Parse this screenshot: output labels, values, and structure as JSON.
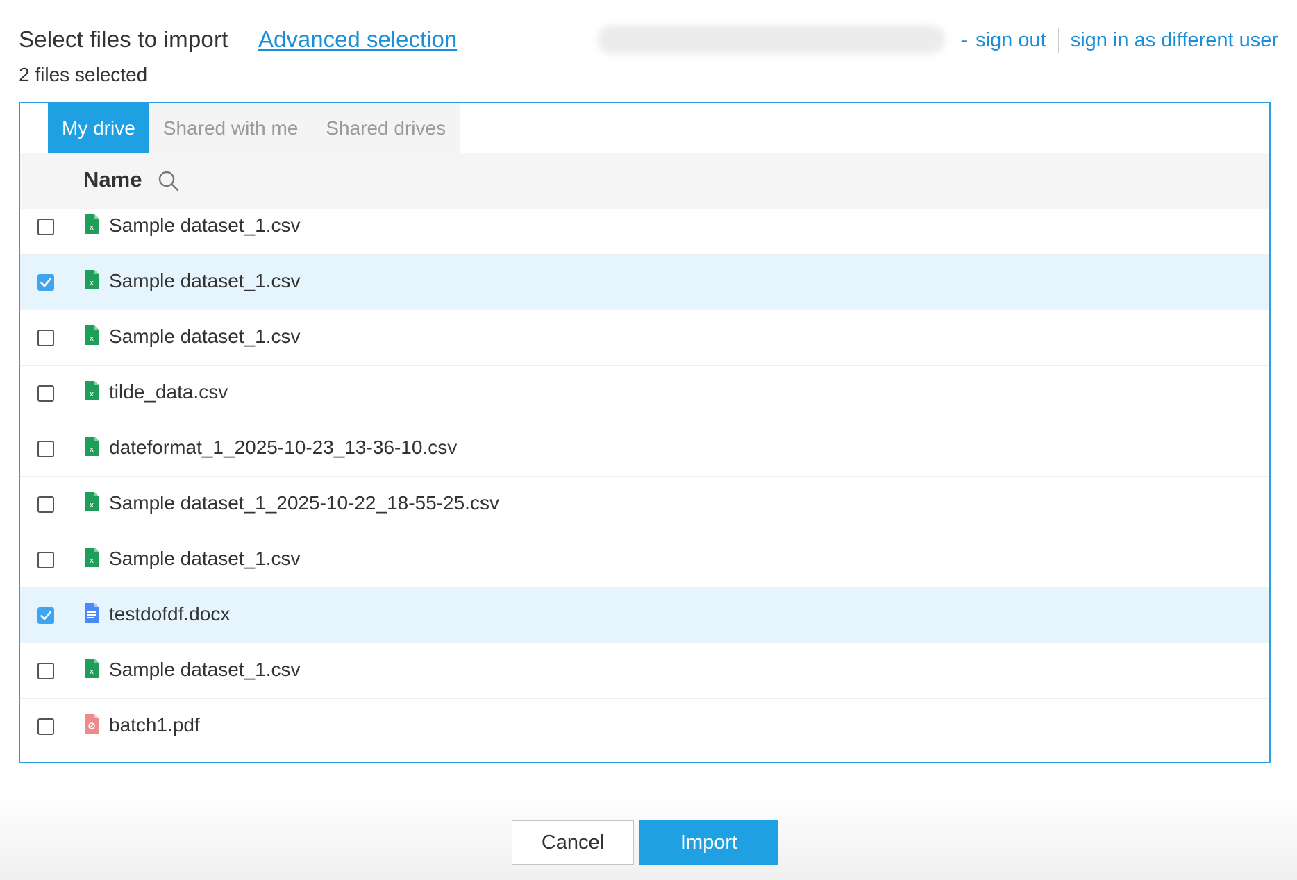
{
  "header": {
    "title": "Select files to import",
    "advanced_link": "Advanced selection",
    "account_dash": "-",
    "sign_out": "sign out",
    "sign_in_different": "sign in as different user",
    "files_selected": "2 files selected"
  },
  "tabs": [
    {
      "label": "My drive",
      "active": true
    },
    {
      "label": "Shared with me",
      "active": false
    },
    {
      "label": "Shared drives",
      "active": false
    }
  ],
  "table": {
    "column_name": "Name",
    "rows": [
      {
        "name": "Sample dataset_1.csv",
        "type": "sheet",
        "checked": false
      },
      {
        "name": "Sample dataset_1.csv",
        "type": "sheet",
        "checked": true
      },
      {
        "name": "Sample dataset_1.csv",
        "type": "sheet",
        "checked": false
      },
      {
        "name": "tilde_data.csv",
        "type": "sheet",
        "checked": false
      },
      {
        "name": "dateformat_1_2025-10-23_13-36-10.csv",
        "type": "sheet",
        "checked": false
      },
      {
        "name": "Sample dataset_1_2025-10-22_18-55-25.csv",
        "type": "sheet",
        "checked": false
      },
      {
        "name": "Sample dataset_1.csv",
        "type": "sheet",
        "checked": false
      },
      {
        "name": "testdofdf.docx",
        "type": "doc",
        "checked": true
      },
      {
        "name": "Sample dataset_1.csv",
        "type": "sheet",
        "checked": false
      },
      {
        "name": "batch1.pdf",
        "type": "pdf",
        "checked": false
      }
    ]
  },
  "buttons": {
    "cancel": "Cancel",
    "import": "Import"
  },
  "icons": {
    "sheet": "spreadsheet-file-icon",
    "doc": "document-file-icon",
    "pdf": "pdf-file-icon",
    "search": "search-icon",
    "check": "checkmark-icon"
  },
  "colors": {
    "accent": "#1fa0e3",
    "link": "#1a8fd8",
    "selected_row": "#e6f4fd",
    "sheet_icon": "#1e9e5a",
    "doc_icon": "#4a8af4",
    "pdf_icon": "#f08a8a"
  }
}
